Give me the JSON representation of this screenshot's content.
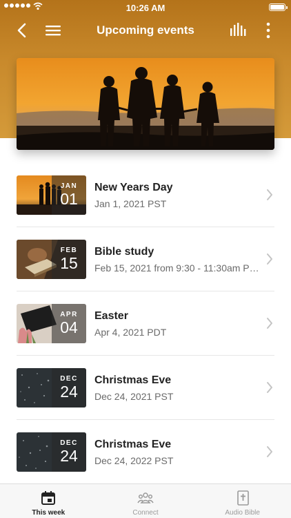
{
  "status_bar": {
    "time": "10:26 AM"
  },
  "nav": {
    "title": "Upcoming events"
  },
  "events": [
    {
      "month": "JAN",
      "day": "01",
      "title": "New Years Day",
      "subtitle": "Jan 1, 2021 PST"
    },
    {
      "month": "FEB",
      "day": "15",
      "title": "Bible study",
      "subtitle": "Feb 15, 2021 from 9:30 - 11:30am PST"
    },
    {
      "month": "APR",
      "day": "04",
      "title": "Easter",
      "subtitle": "Apr 4, 2021 PDT"
    },
    {
      "month": "DEC",
      "day": "24",
      "title": "Christmas Eve",
      "subtitle": "Dec 24, 2021 PST"
    },
    {
      "month": "DEC",
      "day": "24",
      "title": "Christmas Eve",
      "subtitle": "Dec 24, 2022 PST"
    }
  ],
  "tabs": [
    {
      "label": "This week",
      "icon": "calendar-icon",
      "active": true
    },
    {
      "label": "Connect",
      "icon": "people-icon",
      "active": false
    },
    {
      "label": "Audio Bible",
      "icon": "bible-icon",
      "active": false
    }
  ],
  "colors": {
    "header": "#c98a2c",
    "active_tab": "#222222",
    "inactive_tab": "#9a9a9a"
  }
}
